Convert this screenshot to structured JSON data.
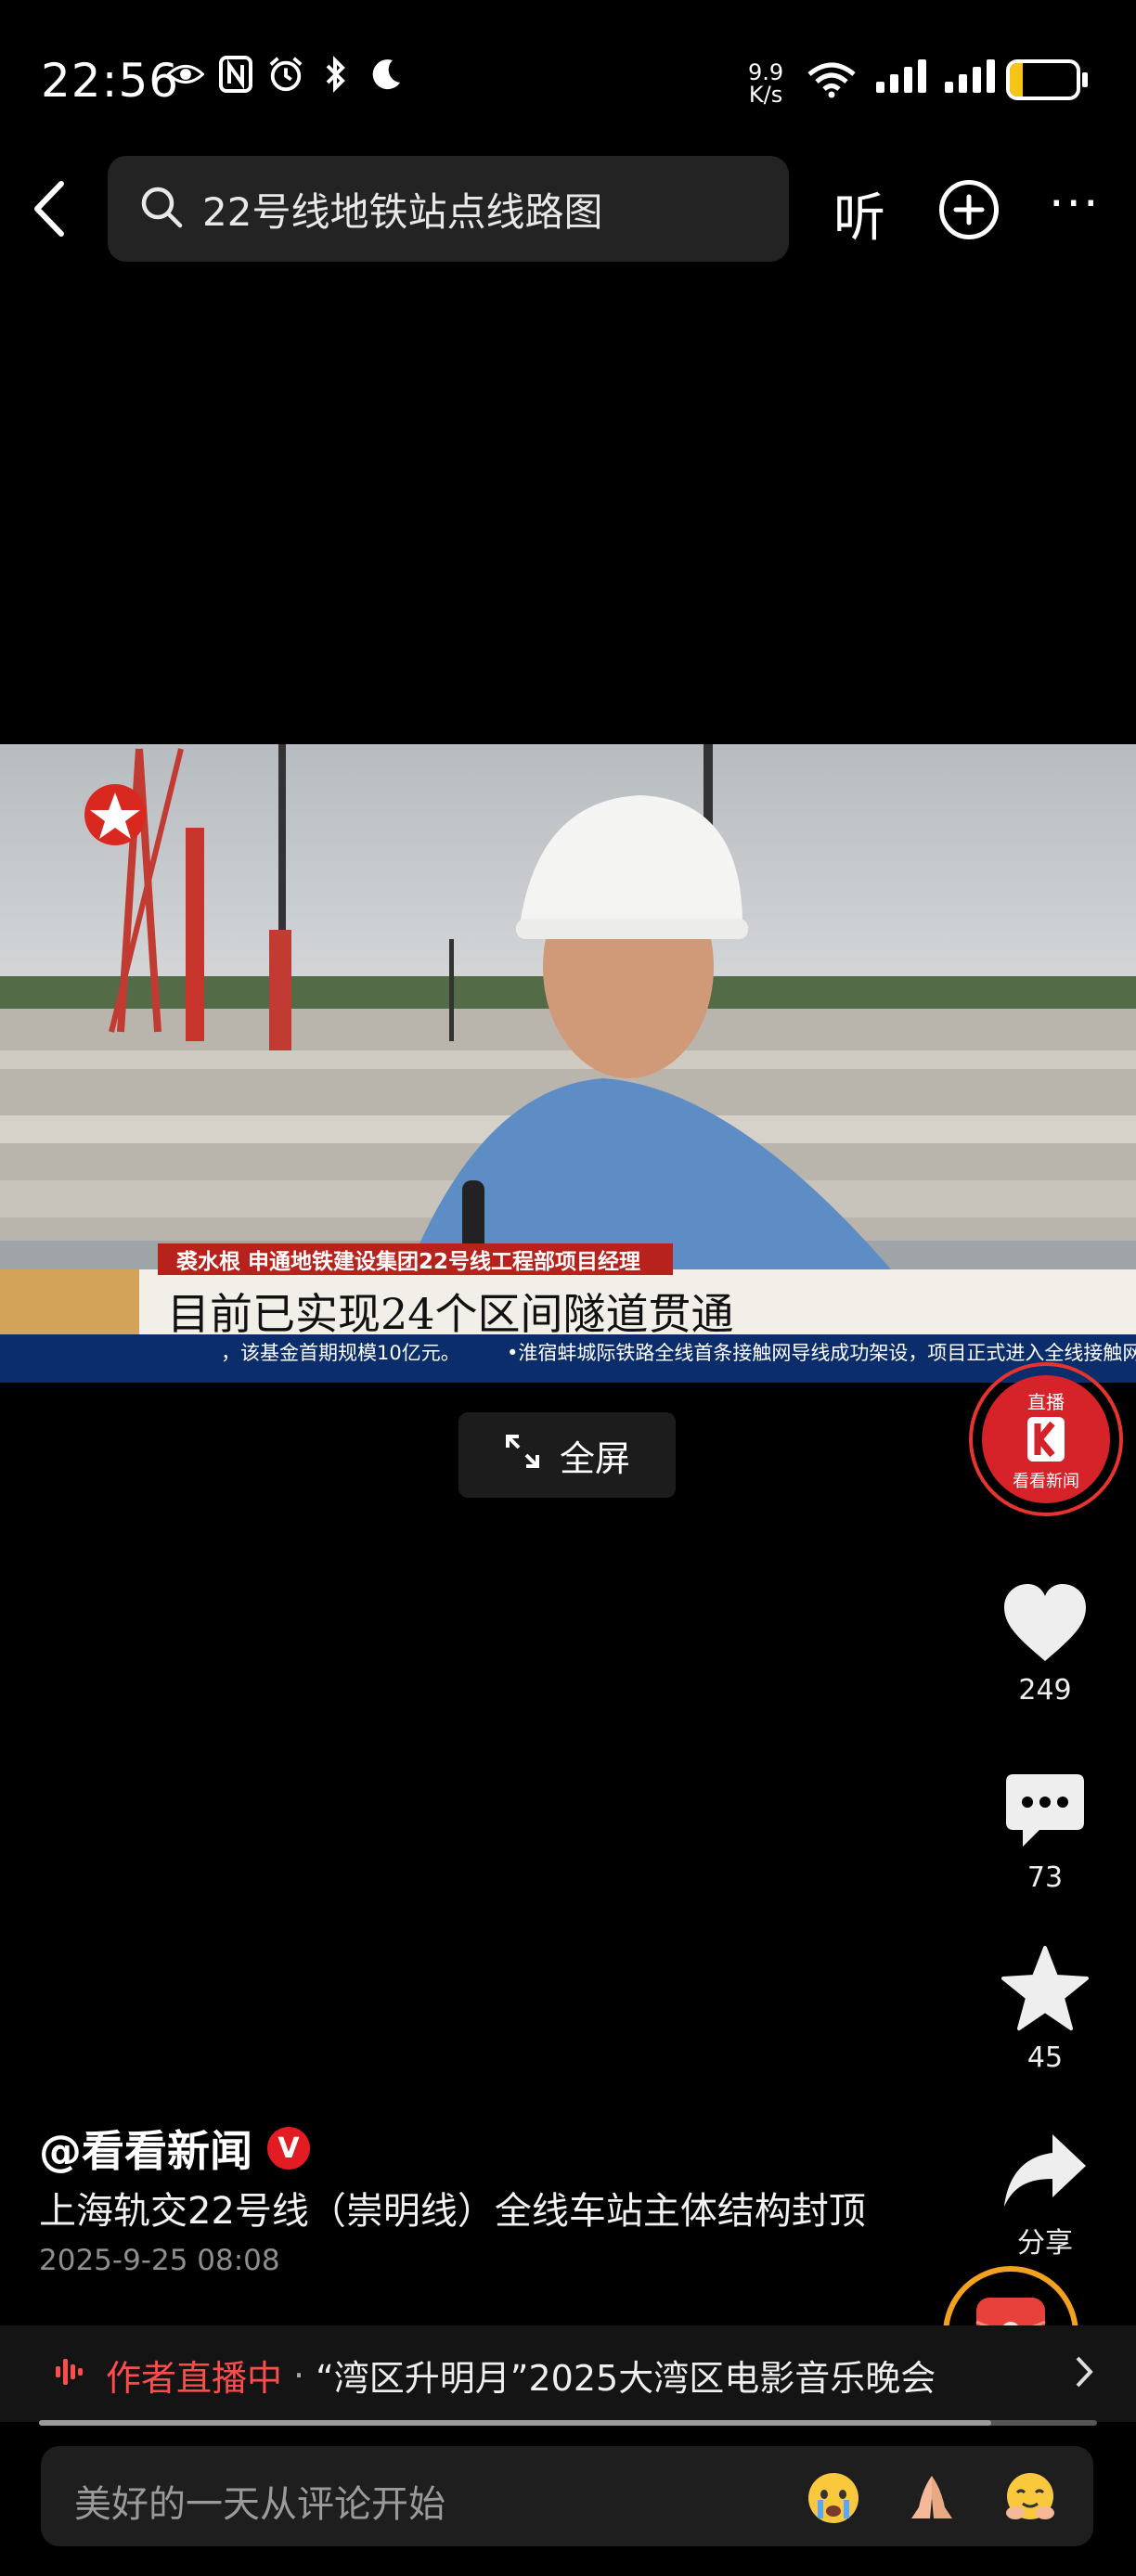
{
  "status_bar": {
    "time": "22:56",
    "net_speed_value": "9.9",
    "net_speed_unit": "K/s",
    "battery_level": "19",
    "battery_fraction": 0.19
  },
  "top_bar": {
    "search_text": "22号线地铁站点线路图",
    "listen_label": "听"
  },
  "video": {
    "speaker_caption": "裘水根 申通地铁建设集团22号线工程部项目经理",
    "headline": "目前已实现24个区间隧道贯通",
    "ticker_left": "，该基金首期规模10亿元。",
    "ticker_right": "•淮宿蚌城际铁路全线首条接触网导线成功架设，项目正式进入全线接触网"
  },
  "fullscreen_label": "全屏",
  "live_badge": {
    "top": "直播",
    "bottom": "看看新闻"
  },
  "rail": {
    "likes": "249",
    "comments": "73",
    "favorites": "45",
    "share_label": "分享"
  },
  "post": {
    "author": "@看看新闻",
    "verified_mark": "V",
    "description": "上海轨交22号线（崇明线）全线车站主体结构封顶",
    "date": "2025-9-25 08:08"
  },
  "live_strip": {
    "status": "作者直播中",
    "separator": "·",
    "title": "“湾区升明月”2025大湾区电影音乐晚会"
  },
  "playback_progress": 0.9,
  "comment": {
    "placeholder": "美好的一天从评论开始"
  },
  "colors": {
    "accent_red": "#e31c23",
    "live_red": "#ff4d4d",
    "battery_yellow": "#f5c518",
    "packet_orange": "#f3a21f"
  }
}
